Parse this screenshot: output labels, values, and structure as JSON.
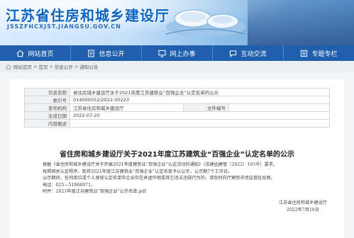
{
  "banner": {
    "title": "江苏省住房和城乡建设厅",
    "url": "JSSZFHCXJST.JIANGSU.GOV.CN"
  },
  "nav": [
    {
      "label": "网站首页",
      "icon": "home-icon"
    },
    {
      "label": "信息公开",
      "icon": "document-icon"
    },
    {
      "label": "网上办事",
      "icon": "computer-icon"
    },
    {
      "label": "互动交流",
      "icon": "chat-icon"
    },
    {
      "label": "专题专栏",
      "icon": "list-icon"
    }
  ],
  "breadcrumb": [
    "网站首页",
    "首页",
    "信息公开",
    "通知公告"
  ],
  "meta": {
    "index_key": "信息名称",
    "index_val": "省住房城乡建设厅关于2021年度江苏建筑业“百强企业”认定名单的公示",
    "num_key": "索引号",
    "num_val": "014000052/2022-00223",
    "org_key": "发布机构",
    "org_val": "江苏省住房和城乡建设厅",
    "doc_key": "文件编号",
    "doc_val": "",
    "date_key": "生成日期",
    "date_val": "2022-07-20",
    "content_key": "内容概述",
    "content_val": ""
  },
  "article": {
    "title": "省住房和城乡建设厅关于2021年度江苏建筑业“百强企业”认定名单的公示",
    "lines": [
      "根据《省住房和城乡建设厅关于开展2021年度建筑业“百强企业”认定活动的通知》（苏建函建管〔2022〕165号）要求，",
      "按照相关认定程序，现将2021年度江苏建筑业“百强企业”认定名单予以公示，公示期7个工作日。",
      "公示期间，任何单位或个人发现认定名单中企业存在弄虚作假或其它违法违规行为的，请及时向厅建筑市场监管处反映。",
      "电话：025—51868971。",
      "附件：2021年度江苏建筑业“百强企业”公示名单.pdf"
    ],
    "sign_org": "江苏省住房和城乡建设厅",
    "sign_date": "2022年7月18日"
  }
}
